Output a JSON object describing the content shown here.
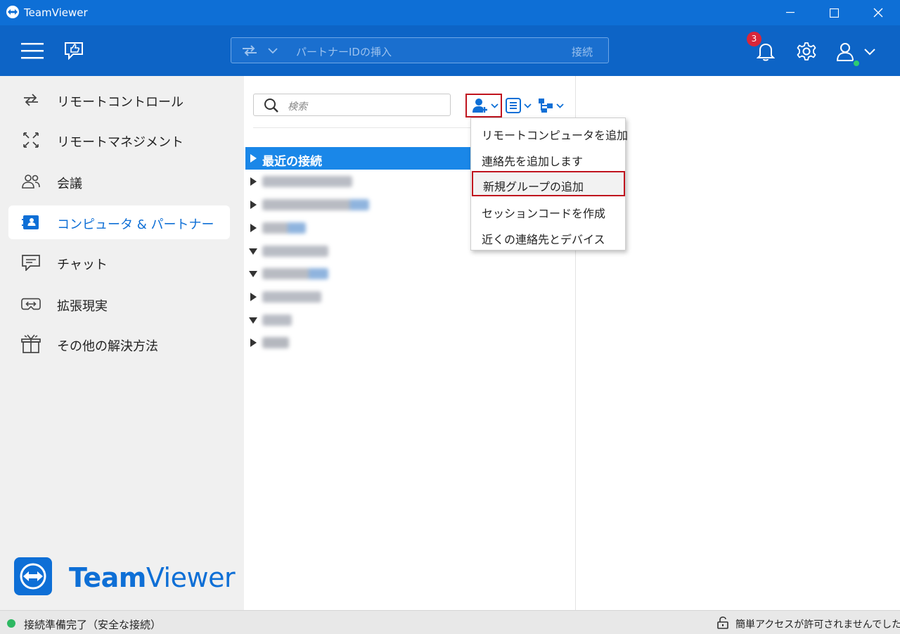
{
  "window": {
    "title": "TeamViewer"
  },
  "topbar": {
    "partner_placeholder": "パートナーIDの挿入",
    "connect_label": "接続",
    "notification_count": "3"
  },
  "sidebar": {
    "items": [
      {
        "label": "リモートコントロール",
        "icon": "remote-control-icon"
      },
      {
        "label": "リモートマネジメント",
        "icon": "remote-management-icon"
      },
      {
        "label": "会議",
        "icon": "meeting-icon"
      },
      {
        "label": "コンピュータ & パートナー",
        "icon": "computers-partners-icon",
        "active": true
      },
      {
        "label": "チャット",
        "icon": "chat-icon"
      },
      {
        "label": "拡張現実",
        "icon": "augmented-reality-icon"
      },
      {
        "label": "その他の解決方法",
        "icon": "gift-icon"
      }
    ],
    "brand": {
      "bold": "Team",
      "regular": "Viewer"
    }
  },
  "middle": {
    "search_placeholder": "検索",
    "tree": [
      {
        "label": "最近の接続",
        "expanded": false,
        "selected": true
      }
    ]
  },
  "menu": {
    "items": [
      "リモートコンピュータを追加",
      "連絡先を追加します",
      "新規グループの追加",
      "セッションコードを作成",
      "近くの連絡先とデバイス"
    ]
  },
  "statusbar": {
    "left": "接続準備完了（安全な接続）",
    "right": "簡単アクセスが許可されませんでした",
    "status_color": "#2db862"
  },
  "colors": {
    "accent": "#0e6fd6",
    "topbar": "#0d64c6",
    "selection": "#1a87e8",
    "highlight_border": "#c0141e"
  }
}
